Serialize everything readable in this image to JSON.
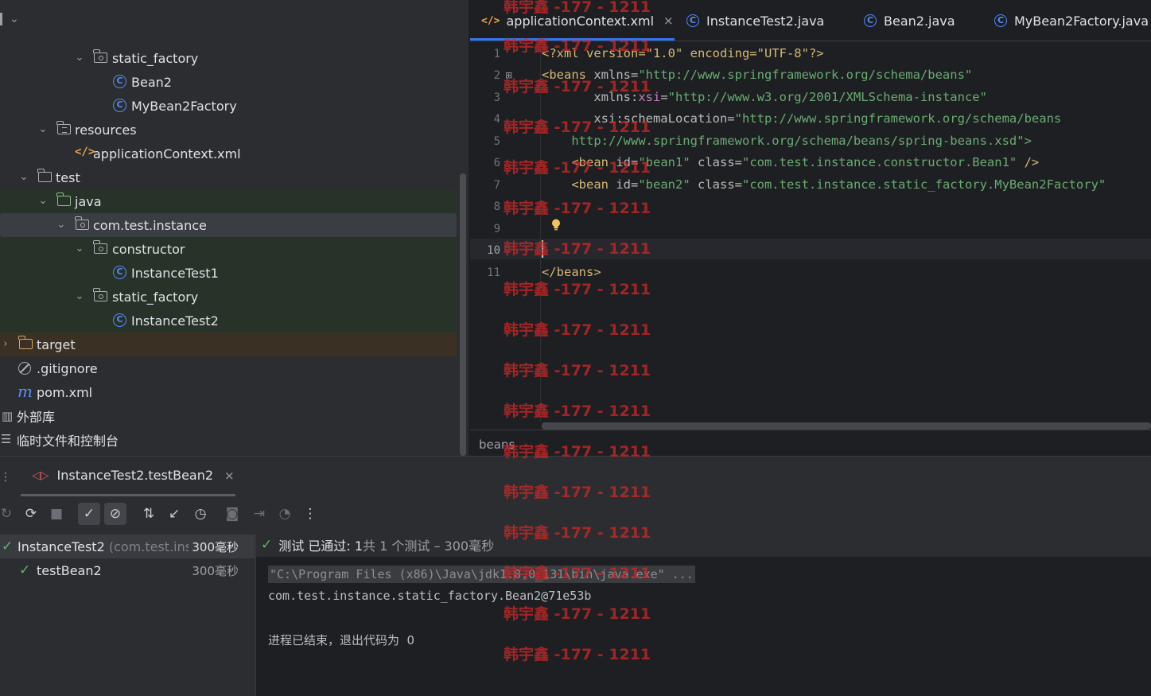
{
  "project_tree": {
    "rows": [
      {
        "label": "static_factory"
      },
      {
        "label": "Bean2"
      },
      {
        "label": "MyBean2Factory"
      },
      {
        "label": "resources"
      },
      {
        "label": "applicationContext.xml"
      },
      {
        "label": "test"
      },
      {
        "label": "java"
      },
      {
        "label": "com.test.instance"
      },
      {
        "label": "constructor"
      },
      {
        "label": "InstanceTest1"
      },
      {
        "label": "static_factory"
      },
      {
        "label": "InstanceTest2"
      },
      {
        "label": "target"
      },
      {
        "label": ".gitignore"
      },
      {
        "label": "pom.xml"
      },
      {
        "label": "外部库"
      },
      {
        "label": "临时文件和控制台"
      }
    ]
  },
  "editor": {
    "tabs": [
      {
        "label": "applicationContext.xml"
      },
      {
        "label": "InstanceTest2.java"
      },
      {
        "label": "Bean2.java"
      },
      {
        "label": "MyBean2Factory.java"
      }
    ],
    "close_glyph": "×",
    "line_numbers": [
      "1",
      "2",
      "3",
      "4",
      "5",
      "6",
      "7",
      "8",
      "9",
      "10",
      "11"
    ],
    "code": {
      "l1": "<?xml version=\"1.0\" encoding=\"UTF-8\"?>",
      "l2_tag": "<beans",
      "l2_attr": " xmlns=",
      "l2_val": "\"http://www.springframework.org/schema/beans\"",
      "l3_pre": "       xmlns:",
      "l3_ns": "xsi",
      "l3_eq": "=",
      "l3_val": "\"http://www.w3.org/2001/XMLSchema-instance\"",
      "l4_pre": "       xsi:schemaLocation=",
      "l4_val": "\"http://www.springframework.org/schema/beans",
      "l5": "    http://www.springframework.org/schema/beans/spring-beans.xsd\">",
      "l6_tag": "    <bean",
      "l6_attr1": " id=",
      "l6_val1": "\"bean1\"",
      "l6_attr2": " class=",
      "l6_val2": "\"com.test.instance.constructor.Bean1\"",
      "l6_end": " />",
      "l7_tag": "    <bean",
      "l7_attr1": " id=",
      "l7_val1": "\"bean2\"",
      "l7_attr2": " class=",
      "l7_val2": "\"com.test.instance.static_factory.MyBean2Factory\"",
      "l11": "</beans>"
    },
    "breadcrumb": "beans"
  },
  "run": {
    "tab_label": "InstanceTest2.testBean2",
    "close_glyph": "×",
    "tests": [
      {
        "name": "InstanceTest2",
        "pkg": "(com.test.inst",
        "time": "300毫秒"
      },
      {
        "name": "testBean2",
        "time": "300毫秒"
      }
    ],
    "status_text": "测试 已通过: 1",
    "status_extra": "共 1 个测试 – 300毫秒",
    "console": [
      "\"C:\\Program Files (x86)\\Java\\jdk1.8.0_131\\bin\\java.exe\" ...",
      "com.test.instance.static_factory.Bean2@71e53b",
      "进程已结束，退出代码为  0"
    ]
  },
  "watermark": "韩宇鑫 -177 - 1211",
  "colors": {
    "accent": "#3574f0",
    "pass": "#5fb865",
    "watermark": "#c82828"
  }
}
